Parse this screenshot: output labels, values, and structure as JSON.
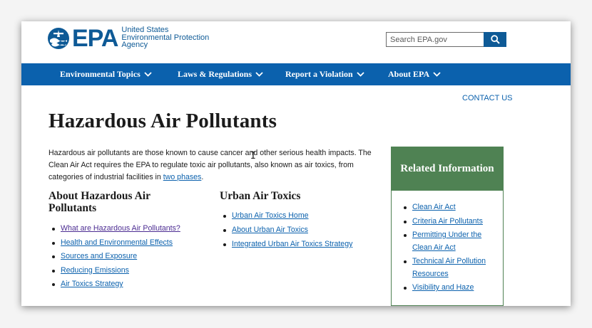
{
  "header": {
    "logo_text": "EPA",
    "agency_line1": "United States",
    "agency_line2": "Environmental Protection",
    "agency_line3": "Agency",
    "search_placeholder": "Search EPA.gov",
    "search_icon": "search-icon"
  },
  "nav": {
    "items": [
      {
        "label": "Environmental Topics"
      },
      {
        "label": "Laws & Regulations"
      },
      {
        "label": "Report a Violation"
      },
      {
        "label": "About EPA"
      }
    ]
  },
  "contact_label": "CONTACT US",
  "page_title": "Hazardous Air Pollutants",
  "intro": {
    "text_before_link": "Hazardous air pollutants are those known to cause cancer and other serious health impacts.  The Clean Air Act requires the EPA to regulate toxic air pollutants, also known as air toxics, from categories of industrial facilities in ",
    "link": "two phases",
    "text_after_link": "."
  },
  "about_section": {
    "heading": "About Hazardous Air Pollutants",
    "links": [
      {
        "label": "What are Hazardous Air Pollutants?"
      },
      {
        "label": "Health and Environmental Effects"
      },
      {
        "label": "Sources and Exposure"
      },
      {
        "label": "Reducing Emissions"
      },
      {
        "label": "Air Toxics Strategy"
      }
    ]
  },
  "urban_section": {
    "heading": "Urban Air Toxics",
    "links": [
      {
        "label": "Urban Air Toxics Home"
      },
      {
        "label": "About Urban Air Toxics"
      },
      {
        "label": "Integrated Urban Air Toxics Strategy"
      }
    ]
  },
  "related": {
    "heading": "Related Information",
    "links": [
      {
        "label": "Clean Air Act"
      },
      {
        "label": "Criteria Air Pollutants"
      },
      {
        "label": "Permitting Under the Clean Air Act"
      },
      {
        "label": "Technical Air Pollution Resources"
      },
      {
        "label": "Visibility and Haze"
      }
    ]
  },
  "colors": {
    "nav_blue": "#0b61ad",
    "logo_blue": "#0e5a96",
    "related_green": "#4f8253",
    "visited_link": "#4c2c92"
  }
}
